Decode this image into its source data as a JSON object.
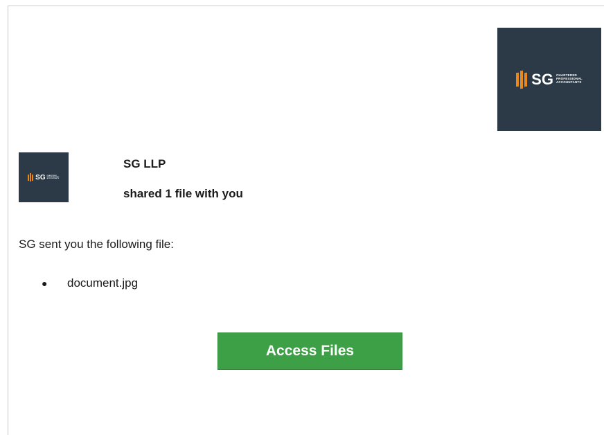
{
  "colors": {
    "logo_background": "#2c3a47",
    "logo_accent": "#e8891e",
    "button_background": "#3d9f46",
    "button_text": "#ffffff"
  },
  "logo": {
    "mark": "SG",
    "tagline": [
      "CHARTERED",
      "PROFESSIONAL",
      "ACCOUNTANTS"
    ]
  },
  "notification": {
    "sender": "SG LLP",
    "action": "shared 1 file with you",
    "intro": "SG sent you the following file:",
    "files": [
      "document.jpg"
    ],
    "button_label": "Access Files"
  }
}
